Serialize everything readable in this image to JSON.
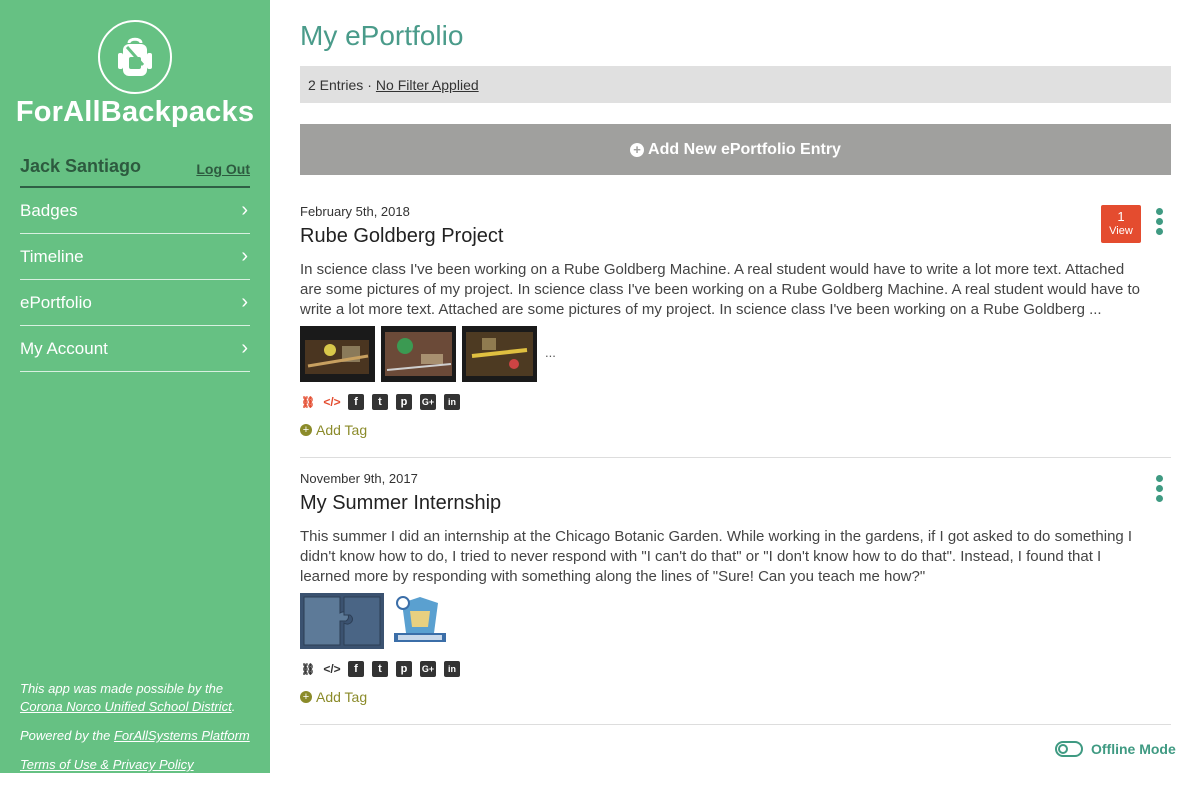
{
  "brand": {
    "name": "ForAllBackpacks",
    "icon": "backpack-icon"
  },
  "user": {
    "name": "Jack Santiago",
    "logout_label": "Log Out"
  },
  "nav": [
    {
      "label": "Badges"
    },
    {
      "label": "Timeline"
    },
    {
      "label": "ePortfolio"
    },
    {
      "label": "My Account"
    }
  ],
  "footer": {
    "made_possible_prefix": "This app was made possible by the",
    "district": "Corona Norco Unified School District",
    "powered_prefix": "Powered by the ",
    "platform": "ForAllSystems Platform",
    "terms": "Terms of Use & Privacy Policy"
  },
  "page": {
    "title": "My ePortfolio",
    "entries_count": "2 Entries",
    "separator": "·",
    "filter": "No Filter Applied",
    "add_entry_label": "Add New ePortfolio Entry"
  },
  "entries": [
    {
      "date": "February 5th, 2018",
      "title": "Rube Goldberg Project",
      "text": "In science class I've been working on a Rube Goldberg Machine. A real student would have to write a lot more text. Attached are some pictures of my project. In science class I've been working on a Rube Goldberg Machine. A real student would have to write a lot more text. Attached are some pictures of my project. In science class I've been working on a Rube Goldberg ...",
      "views": {
        "count": "1",
        "label": "View"
      },
      "more_images": "...",
      "add_tag": "Add Tag"
    },
    {
      "date": "November 9th, 2017",
      "title": "My Summer Internship",
      "text": "This summer I did an internship at the Chicago Botanic Garden. While working in the gardens, if I got asked to do something I didn't know how to do, I tried to never respond with \"I can't do that\" or \"I don't know how to do that\". Instead, I found that I learned more by responding with something along the lines of \"Sure! Can you teach me how?\"",
      "add_tag": "Add Tag"
    }
  ],
  "offline": {
    "label": "Offline Mode"
  },
  "colors": {
    "sidebar": "#66c183",
    "accent": "#3f9a82",
    "badge": "#e44c2f",
    "add_button": "#a0a09e"
  }
}
